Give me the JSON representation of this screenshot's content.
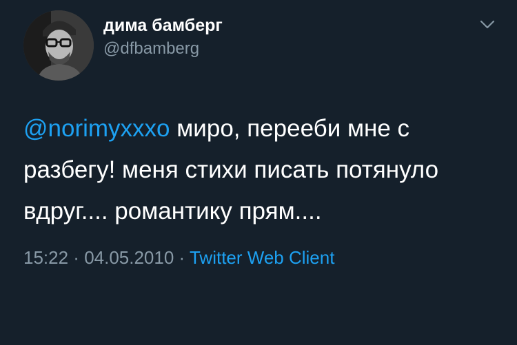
{
  "user": {
    "display_name": "дима бамберг",
    "handle": "@dfbamberg"
  },
  "tweet": {
    "mention": "@norimyxxxo",
    "text": " миро, перееби мне с разбегу! меня стихи писать потянуло вдруг.... романтику прям...."
  },
  "meta": {
    "time": "15:22",
    "separator1": " · ",
    "date": "04.05.2010",
    "separator2": " · ",
    "source": "Twitter Web Client"
  },
  "colors": {
    "background": "#15202b",
    "accent": "#1da1f2",
    "secondary_text": "#8899a6"
  },
  "icons": {
    "menu": "chevron-down-icon"
  }
}
